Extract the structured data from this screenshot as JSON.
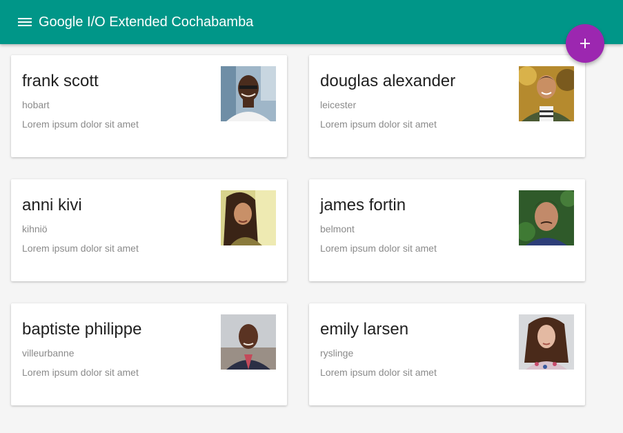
{
  "app": {
    "title": "Google I/O Extended Cochabamba",
    "accent": "#009688",
    "fab_color": "#9c27b0"
  },
  "icons": {
    "menu": "menu-icon",
    "fab": "add-icon"
  },
  "cards": [
    {
      "name": "frank scott",
      "city": "hobart",
      "description": "Lorem ipsum dolor sit amet"
    },
    {
      "name": "douglas alexander",
      "city": "leicester",
      "description": "Lorem ipsum dolor sit amet"
    },
    {
      "name": "anni kivi",
      "city": "kihniö",
      "description": "Lorem ipsum dolor sit amet"
    },
    {
      "name": "james fortin",
      "city": "belmont",
      "description": "Lorem ipsum dolor sit amet"
    },
    {
      "name": "baptiste philippe",
      "city": "villeurbanne",
      "description": "Lorem ipsum dolor sit amet"
    },
    {
      "name": "emily larsen",
      "city": "ryslinge",
      "description": "Lorem ipsum dolor sit amet"
    }
  ]
}
